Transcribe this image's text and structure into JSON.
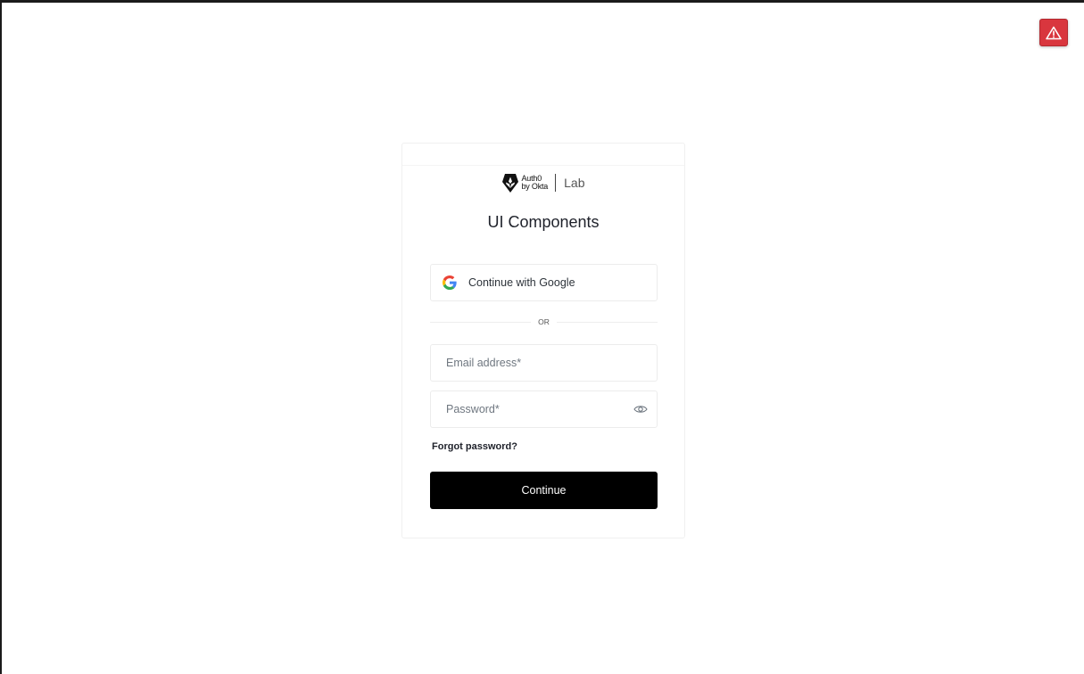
{
  "alert": {
    "icon": "warning-triangle-icon",
    "color": "#d9363e"
  },
  "logo": {
    "brand_line1": "Auth0",
    "brand_line2": "by Okta",
    "suffix": "Lab",
    "icon": "auth0-shield-icon"
  },
  "card": {
    "title": "UI Components"
  },
  "social": {
    "google_label": "Continue with Google",
    "icon": "google-g-icon"
  },
  "separator": {
    "text": "OR"
  },
  "form": {
    "email_placeholder": "Email address*",
    "email_value": "",
    "password_placeholder": "Password*",
    "password_value": "",
    "password_toggle_icon": "eye-icon",
    "forgot_label": "Forgot password?",
    "continue_label": "Continue"
  },
  "colors": {
    "primary_button": "#000000",
    "alert": "#d9363e",
    "text": "#1e212a"
  }
}
